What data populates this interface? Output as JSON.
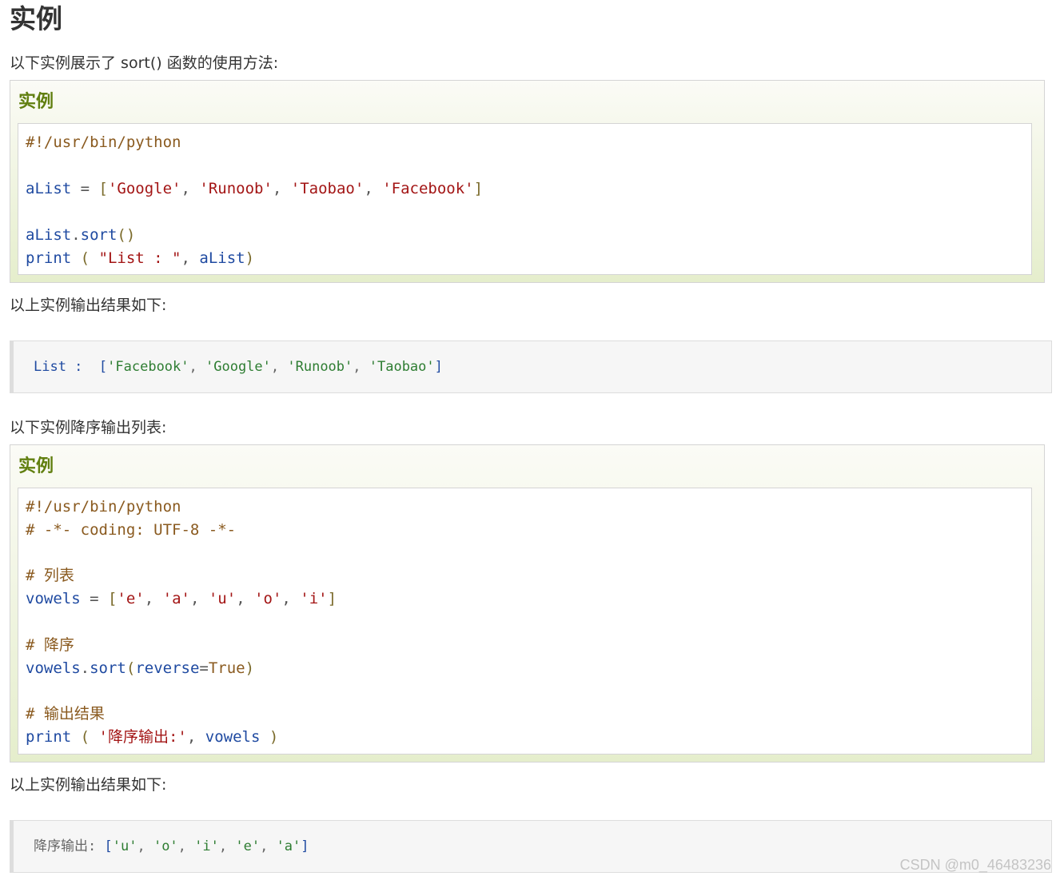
{
  "page_title": "实例",
  "intro_1": "以下实例展示了 sort() 函数的使用方法:",
  "example_1": {
    "heading": "实例",
    "line1": "#!/usr/bin/python",
    "line2": {
      "var": "aList",
      "eq": " = ",
      "lb": "[",
      "s1": "'Google'",
      "c1": ", ",
      "s2": "'Runoob'",
      "c2": ", ",
      "s3": "'Taobao'",
      "c3": ", ",
      "s4": "'Facebook'",
      "rb": "]"
    },
    "line3": {
      "obj": "aList",
      "dot": ".",
      "fn": "sort",
      "parens": "()"
    },
    "line4": {
      "fn": "print",
      "open": " ( ",
      "str": "\"List : \"",
      "comma": ", ",
      "arg": "aList",
      "close": ")"
    }
  },
  "result_label_1": "以上实例输出结果如下:",
  "output_1": {
    "label": "List :",
    "lb": "[",
    "s1": "'Facebook'",
    "s2": "'Google'",
    "s3": "'Runoob'",
    "s4": "'Taobao'",
    "sep": ", ",
    "rb": "]"
  },
  "intro_2": "以下实例降序输出列表:",
  "example_2": {
    "heading": "实例",
    "line1": "#!/usr/bin/python",
    "line2": "# -*- coding: UTF-8 -*-",
    "line3": "# 列表",
    "line4": {
      "var": "vowels",
      "eq": " = ",
      "lb": "[",
      "s1": "'e'",
      "s2": "'a'",
      "s3": "'u'",
      "s4": "'o'",
      "s5": "'i'",
      "sep": ", ",
      "rb": "]"
    },
    "line5": "# 降序",
    "line6": {
      "obj": "vowels",
      "dot": ".",
      "fn": "sort",
      "open": "(",
      "kwarg": "reverse",
      "eq": "=",
      "val": "True",
      "close": ")"
    },
    "line7": "# 输出结果",
    "line8": {
      "fn": "print",
      "open": " ( ",
      "str": "'降序输出:'",
      "comma": ", ",
      "arg": "vowels",
      "close": " )"
    }
  },
  "result_label_2": "以上实例输出结果如下:",
  "output_2": {
    "label": "降序输出:",
    "lb": "[",
    "s1": "'u'",
    "s2": "'o'",
    "s3": "'i'",
    "s4": "'e'",
    "s5": "'a'",
    "sep": ", ",
    "rb": "]"
  },
  "watermark": "CSDN @m0_46483236",
  "colors": {
    "heading_green": "#617f10",
    "comment": "#8a5a1f",
    "keyword": "#1f4aa1",
    "string": "#a31515",
    "output_string": "#2e7d32"
  }
}
